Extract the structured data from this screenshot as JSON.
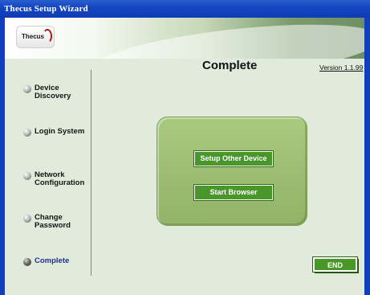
{
  "window": {
    "title": "Thecus Setup Wizard"
  },
  "banner": {
    "logo_text": "Thecus"
  },
  "sidebar": {
    "steps": [
      {
        "label": "Device Discovery",
        "active": false
      },
      {
        "label": "Login System",
        "active": false
      },
      {
        "label": "Network Configuration",
        "active": false
      },
      {
        "label": "Change Password",
        "active": false
      },
      {
        "label": "Complete",
        "active": true
      }
    ]
  },
  "main": {
    "title": "Complete",
    "version": "Version 1.1.99",
    "buttons": {
      "setup_other": "Setup Other Device",
      "start_browser": "Start Browser",
      "end": "END"
    }
  },
  "colors": {
    "titlebar": "#1546c2",
    "background": "#e0ebdb",
    "panel": "#9dbe72",
    "button": "#49962b",
    "active_step": "#1c2f93"
  },
  "icons": {
    "step_bullet": "radio-bullet-icon",
    "logo_mark": "thecus-swirl-icon"
  }
}
